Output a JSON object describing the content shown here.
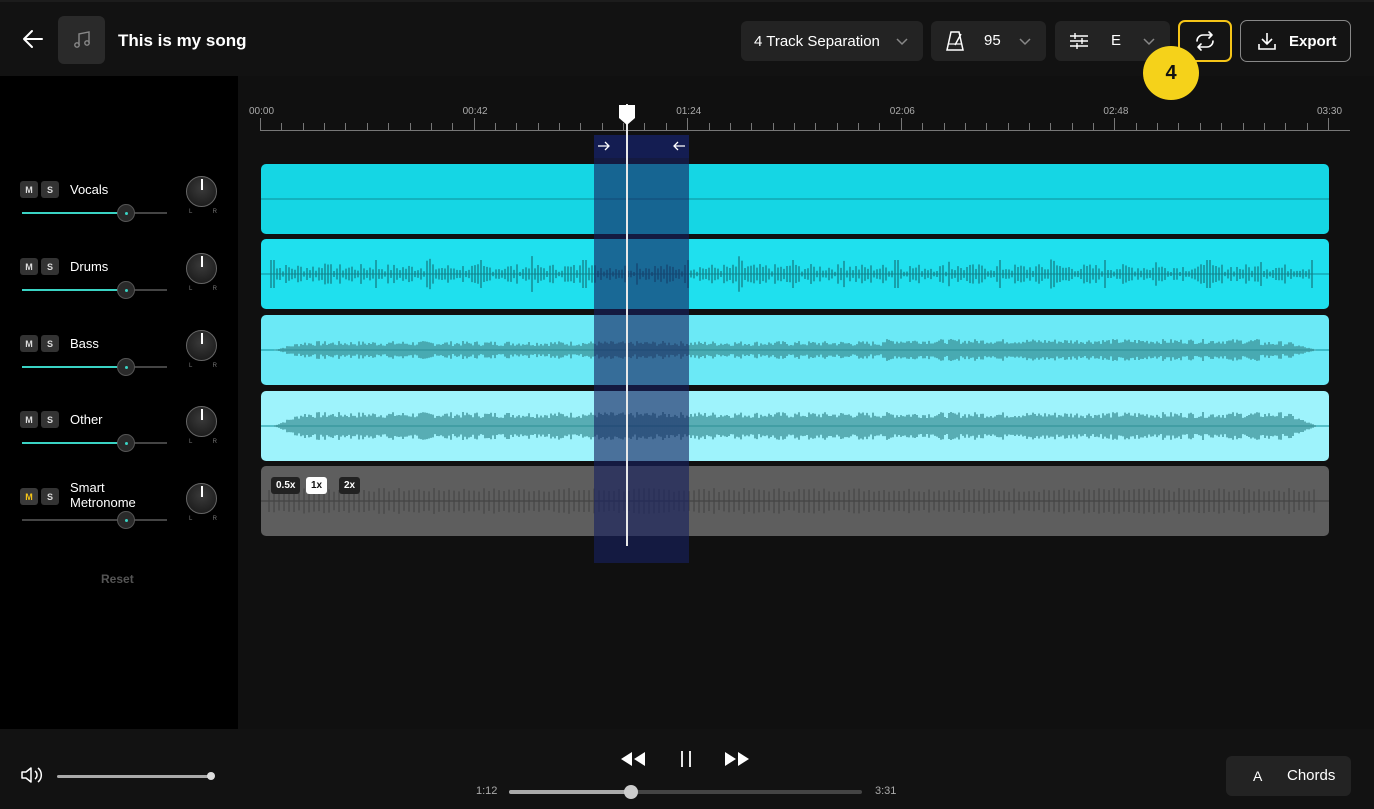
{
  "header": {
    "title": "This is my song",
    "separation_label": "4 Track Separation",
    "tempo_value": "95",
    "key_value": "E",
    "export_label": "Export",
    "step_badge": "4"
  },
  "tracks": [
    {
      "name": "Vocals",
      "mute": "M",
      "solo": "S",
      "volume": 0.72,
      "color": "#15d6e4",
      "waveform": "flat"
    },
    {
      "name": "Drums",
      "mute": "M",
      "solo": "S",
      "volume": 0.72,
      "color": "#1fe0ee",
      "waveform": "drums"
    },
    {
      "name": "Bass",
      "mute": "M",
      "solo": "S",
      "volume": 0.72,
      "color": "#6be9f6",
      "waveform": "bass"
    },
    {
      "name": "Other",
      "mute": "M",
      "solo": "S",
      "volume": 0.72,
      "color": "#9ef3fc",
      "waveform": "other"
    },
    {
      "name": "Smart Metronome",
      "mute": "M",
      "solo": "S",
      "volume": 0.72,
      "color": "#5e5e5e",
      "waveform": "metronome",
      "mute_active": true
    }
  ],
  "pan_labels": {
    "left": "L",
    "right": "R"
  },
  "reset_label": "Reset",
  "metronome_speeds": [
    {
      "label": "0.5x",
      "selected": false
    },
    {
      "label": "1x",
      "selected": true
    },
    {
      "label": "2x",
      "selected": false
    }
  ],
  "ruler": {
    "labels": [
      "00:00",
      "00:42",
      "01:24",
      "02:06",
      "02:48",
      "03:30"
    ]
  },
  "loop_region": {
    "start": "01:07",
    "end": "01:27"
  },
  "transport": {
    "current_time": "1:12",
    "total_time": "3:31",
    "progress": 0.345,
    "master_volume": 1.0
  },
  "chords": {
    "key": "A",
    "label": "Chords"
  },
  "colors": {
    "accent": "#f5c518",
    "teal": "#3ad3c4"
  },
  "icons": [
    "back-arrow-icon",
    "music-note-icon",
    "chevron-down-icon",
    "metronome-icon",
    "equalizer-icon",
    "loop-icon",
    "download-icon",
    "volume-icon",
    "rewind-icon",
    "pause-icon",
    "fast-forward-icon",
    "arrow-right-icon",
    "arrow-left-icon",
    "playhead-icon"
  ]
}
